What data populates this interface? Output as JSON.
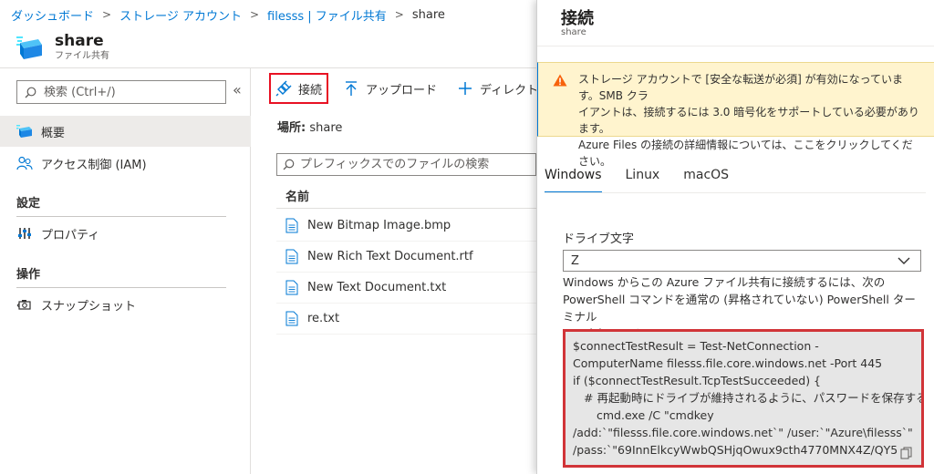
{
  "breadcrumb": {
    "items": [
      "ダッシュボード",
      "ストレージ アカウント",
      "filesss | ファイル共有"
    ],
    "current": "share"
  },
  "resource": {
    "title": "share",
    "subtitle": "ファイル共有"
  },
  "sidebar": {
    "search_placeholder": "検索 (Ctrl+/)",
    "collapse": "«",
    "items": [
      {
        "label": "概要",
        "icon": "file-share-icon"
      },
      {
        "label": "アクセス制御 (IAM)",
        "icon": "people-icon"
      }
    ],
    "sections": [
      {
        "title": "設定",
        "items": [
          {
            "label": "プロパティ",
            "icon": "properties-icon"
          }
        ]
      },
      {
        "title": "操作",
        "items": [
          {
            "label": "スナップショット",
            "icon": "snapshot-icon"
          }
        ]
      }
    ]
  },
  "toolbar": {
    "connect": "接続",
    "upload": "アップロード",
    "add_directory": "ディレクトリの追加"
  },
  "location": {
    "label": "場所:",
    "value": "share"
  },
  "file_search": {
    "placeholder": "プレフィックスでのファイルの検索"
  },
  "file_table": {
    "column": "名前",
    "rows": [
      "New Bitmap Image.bmp",
      "New Rich Text Document.rtf",
      "New Text Document.txt",
      "re.txt"
    ]
  },
  "panel": {
    "title": "接続",
    "subtitle": "share",
    "warning": {
      "line1": "ストレージ アカウントで [安全な転送が必須] が有効になっています。SMB クラ",
      "line2": "イアントは、接続するには 3.0 暗号化をサポートしている必要があります。",
      "line3": "Azure Files の接続の詳細情報については、ここをクリックしてください。"
    },
    "tabs": [
      "Windows",
      "Linux",
      "macOS"
    ],
    "drive_label": "ドライブ文字",
    "drive_value": "Z",
    "description": {
      "line1": "Windows からこの Azure ファイル共有に接続するには、次の",
      "line2": "PowerShell コマンドを通常の (昇格されていない) PowerShell ターミナル",
      "line3": "から実行します:"
    },
    "code": {
      "line1": "$connectTestResult = Test-NetConnection -",
      "line2": "ComputerName filesss.file.core.windows.net -Port 445",
      "line3": "if ($connectTestResult.TcpTestSucceeded) {",
      "line4": "# 再起動時にドライブが維持されるように、パスワードを保存する",
      "line5": "cmd.exe /C \"cmdkey",
      "line6": "/add:`\"filesss.file.core.windows.net`\" /user:`\"Azure\\filesss`\"",
      "line7": "/pass:`\"69InnElkcyWwbQSHjqOwux9cth4770MNX4Z/QY5"
    }
  },
  "colors": {
    "accent": "#0078d4",
    "highlight_border": "#e81123",
    "warning_bg": "#fff4ce",
    "warning_icon": "#f7630c"
  }
}
